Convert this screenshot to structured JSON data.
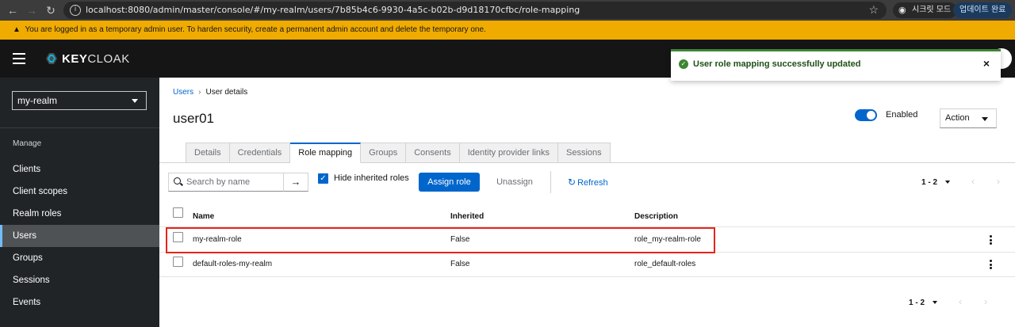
{
  "browser": {
    "url": "localhost:8080/admin/master/console/#/my-realm/users/7b85b4c6-9930-4a5c-b02b-d9d18170cfbc/role-mapping",
    "incognito_label": "시크릿 모드",
    "update_label": "업데이트 완료"
  },
  "banner": {
    "text": "You are logged in as a temporary admin user. To harden security, create a permanent admin account and delete the temporary one."
  },
  "header": {
    "logo_bold": "KEY",
    "logo_rest": "CLOAK"
  },
  "toast": {
    "message": "User role mapping successfully updated",
    "close": "×"
  },
  "sidebar": {
    "realm": "my-realm",
    "section": "Manage",
    "items": [
      {
        "label": "Clients"
      },
      {
        "label": "Client scopes"
      },
      {
        "label": "Realm roles"
      },
      {
        "label": "Users",
        "active": true
      },
      {
        "label": "Groups"
      },
      {
        "label": "Sessions"
      },
      {
        "label": "Events"
      }
    ]
  },
  "breadcrumb": {
    "parent": "Users",
    "current": "User details"
  },
  "page": {
    "title": "user01",
    "enabled_label": "Enabled",
    "action_label": "Action"
  },
  "tabs": [
    "Details",
    "Credentials",
    "Role mapping",
    "Groups",
    "Consents",
    "Identity provider links",
    "Sessions"
  ],
  "active_tab": "Role mapping",
  "toolbar": {
    "search_placeholder": "Search by name",
    "hide_inherited_label": "Hide inherited roles",
    "hide_inherited_checked": true,
    "assign_label": "Assign role",
    "unassign_label": "Unassign",
    "refresh_label": "Refresh",
    "pagination": "1 - 2"
  },
  "table": {
    "columns": [
      "Name",
      "Inherited",
      "Description"
    ],
    "rows": [
      {
        "name": "my-realm-role",
        "inherited": "False",
        "description": "role_my-realm-role",
        "highlighted": true
      },
      {
        "name": "default-roles-my-realm",
        "inherited": "False",
        "description": "role_default-roles"
      }
    ]
  },
  "footer": {
    "pagination": "1 - 2"
  },
  "colors": {
    "brand_blue": "#0066cc",
    "banner_warning": "#f0ab00",
    "success_green": "#3e8635",
    "highlight_red": "#e8231a"
  }
}
